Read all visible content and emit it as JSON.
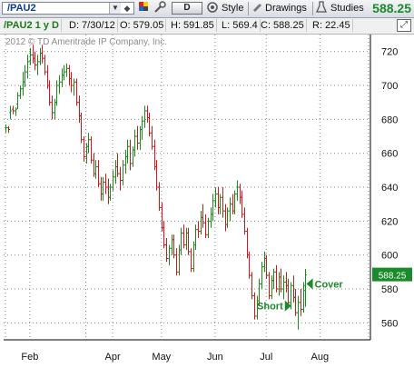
{
  "toolbar": {
    "symbol": "/PAU2",
    "dropdown_glyph": "▼",
    "draw_button": "D",
    "style_label": "Style",
    "drawings_label": "Drawings",
    "studies_label": "Studies",
    "last_price": "588.25",
    "last_price_color": "#1a8a2a"
  },
  "infobar": {
    "symbol_period": "/PAU2 1 y D",
    "date": "D: 7/30/12",
    "open": "O: 579.05",
    "high": "H: 591.85",
    "low": "L: 569.4",
    "close": "C: 588.25",
    "range": "R: 22.45"
  },
  "copyright": "2012 © TD Ameritrade IP Company, Inc.",
  "annotations": {
    "short_label": "Short",
    "cover_label": "Cover",
    "price_tag": "588.25"
  },
  "colors": {
    "up": "#1a8a1a",
    "down": "#cc1a1a",
    "grid": "#8a8a8a",
    "accent": "#1a8a2a"
  },
  "chart_data": {
    "type": "candlestick",
    "ylim": [
      550,
      730
    ],
    "y_ticks": [
      560,
      580,
      600,
      620,
      640,
      660,
      680,
      700,
      720
    ],
    "x_ticks": [
      "Feb",
      "Apr",
      "May",
      "Jun",
      "Jul",
      "Aug"
    ],
    "xlim": [
      0,
      149
    ],
    "x_tick_pos": [
      10,
      44,
      64,
      86,
      107,
      129
    ],
    "month_grid_pos": [
      0,
      10,
      33,
      44,
      64,
      86,
      107,
      129,
      149
    ],
    "last_close": 588.25,
    "short_signal_index": 118,
    "cover_signal_index": 122,
    "ohlc": [
      [
        675.0,
        677.0,
        672.0,
        675.0
      ],
      [
        675.0,
        676.0,
        672.0,
        674.0
      ],
      [
        684.0,
        688.0,
        680.0,
        685.0
      ],
      [
        686.0,
        688.0,
        683.0,
        685.0
      ],
      [
        685.0,
        687.0,
        682.0,
        686.0
      ],
      [
        689.0,
        696.0,
        686.0,
        694.0
      ],
      [
        694.0,
        700.0,
        692.0,
        698.0
      ],
      [
        698.0,
        708.0,
        694.0,
        702.0
      ],
      [
        702.0,
        712.0,
        699.0,
        708.0
      ],
      [
        708.0,
        718.0,
        704.0,
        714.0
      ],
      [
        714.0,
        722.0,
        712.0,
        718.0
      ],
      [
        718.0,
        724.0,
        713.0,
        716.0
      ],
      [
        716.0,
        720.0,
        709.0,
        712.0
      ],
      [
        712.0,
        718.0,
        706.0,
        714.0
      ],
      [
        714.0,
        722.0,
        712.0,
        719.0
      ],
      [
        719.0,
        724.0,
        713.0,
        716.0
      ],
      [
        716.0,
        718.0,
        706.0,
        708.0
      ],
      [
        708.0,
        712.0,
        698.0,
        700.0
      ],
      [
        700.0,
        703.0,
        688.0,
        690.0
      ],
      [
        690.0,
        694.0,
        680.0,
        684.0
      ],
      [
        684.0,
        692.0,
        680.0,
        690.0
      ],
      [
        690.0,
        703.0,
        688.0,
        700.0
      ],
      [
        700.0,
        706.0,
        695.0,
        702.0
      ],
      [
        702.0,
        710.0,
        699.0,
        706.0
      ],
      [
        706.0,
        712.0,
        703.0,
        708.0
      ],
      [
        708.0,
        713.0,
        705.0,
        710.0
      ],
      [
        710.0,
        712.0,
        700.0,
        704.0
      ],
      [
        704.0,
        708.0,
        696.0,
        700.0
      ],
      [
        700.0,
        704.0,
        694.0,
        702.0
      ],
      [
        702.0,
        704.0,
        688.0,
        690.0
      ],
      [
        690.0,
        694.0,
        678.0,
        682.0
      ],
      [
        682.0,
        684.0,
        666.0,
        668.0
      ],
      [
        668.0,
        670.0,
        655.0,
        658.0
      ],
      [
        658.0,
        666.0,
        654.0,
        664.0
      ],
      [
        664.0,
        672.0,
        660.0,
        668.0
      ],
      [
        668.0,
        670.0,
        654.0,
        656.0
      ],
      [
        656.0,
        660.0,
        646.0,
        648.0
      ],
      [
        648.0,
        656.0,
        645.0,
        652.0
      ],
      [
        652.0,
        656.0,
        640.0,
        642.0
      ],
      [
        642.0,
        646.0,
        632.0,
        636.0
      ],
      [
        636.0,
        646.0,
        632.0,
        643.0
      ],
      [
        643.0,
        648.0,
        636.0,
        640.0
      ],
      [
        640.0,
        645.0,
        630.0,
        634.0
      ],
      [
        634.0,
        642.0,
        632.0,
        640.0
      ],
      [
        640.0,
        650.0,
        638.0,
        646.0
      ],
      [
        646.0,
        656.0,
        642.0,
        652.0
      ],
      [
        652.0,
        660.0,
        646.0,
        648.0
      ],
      [
        648.0,
        652.0,
        638.0,
        644.0
      ],
      [
        644.0,
        656.0,
        641.0,
        653.0
      ],
      [
        653.0,
        662.0,
        648.0,
        658.0
      ],
      [
        658.0,
        668.0,
        654.0,
        664.0
      ],
      [
        664.0,
        668.0,
        650.0,
        654.0
      ],
      [
        654.0,
        664.0,
        652.0,
        662.0
      ],
      [
        662.0,
        674.0,
        658.0,
        670.0
      ],
      [
        670.0,
        676.0,
        662.0,
        666.0
      ],
      [
        666.0,
        676.0,
        662.0,
        674.0
      ],
      [
        674.0,
        682.0,
        668.0,
        679.0
      ],
      [
        679.0,
        688.0,
        675.0,
        685.0
      ],
      [
        685.0,
        688.0,
        678.0,
        681.0
      ],
      [
        681.0,
        684.0,
        670.0,
        672.0
      ],
      [
        672.0,
        676.0,
        662.0,
        664.0
      ],
      [
        664.0,
        668.0,
        650.0,
        652.0
      ],
      [
        652.0,
        656.0,
        638.0,
        640.0
      ],
      [
        640.0,
        643.0,
        626.0,
        628.0
      ],
      [
        628.0,
        631.0,
        614.0,
        616.0
      ],
      [
        616.0,
        620.0,
        604.0,
        606.0
      ],
      [
        606.0,
        610.0,
        596.0,
        598.0
      ],
      [
        598.0,
        606.0,
        594.0,
        604.0
      ],
      [
        604.0,
        612.0,
        600.0,
        609.0
      ],
      [
        609.0,
        612.0,
        598.0,
        600.0
      ],
      [
        600.0,
        604.0,
        588.0,
        590.0
      ],
      [
        590.0,
        606.0,
        588.0,
        603.0
      ],
      [
        603.0,
        616.0,
        600.0,
        613.0
      ],
      [
        613.0,
        618.0,
        604.0,
        606.0
      ],
      [
        606.0,
        616.0,
        603.0,
        613.0
      ],
      [
        613.0,
        616.0,
        600.0,
        602.0
      ],
      [
        602.0,
        604.0,
        590.0,
        592.0
      ],
      [
        592.0,
        608.0,
        590.0,
        606.0
      ],
      [
        606.0,
        618.0,
        603.0,
        615.0
      ],
      [
        615.0,
        620.0,
        610.0,
        614.0
      ],
      [
        614.0,
        626.0,
        612.0,
        622.0
      ],
      [
        622.0,
        630.0,
        616.0,
        619.0
      ],
      [
        619.0,
        624.0,
        610.0,
        612.0
      ],
      [
        612.0,
        622.0,
        610.0,
        620.0
      ],
      [
        620.0,
        628.0,
        616.0,
        624.0
      ],
      [
        624.0,
        636.0,
        620.0,
        632.0
      ],
      [
        632.0,
        640.0,
        628.0,
        636.0
      ],
      [
        636.0,
        640.0,
        624.0,
        628.0
      ],
      [
        628.0,
        636.0,
        624.0,
        634.0
      ],
      [
        634.0,
        640.0,
        622.0,
        626.0
      ],
      [
        626.0,
        630.0,
        614.0,
        618.0
      ],
      [
        618.0,
        628.0,
        616.0,
        626.0
      ],
      [
        626.0,
        634.0,
        620.0,
        630.0
      ],
      [
        630.0,
        636.0,
        624.0,
        626.0
      ],
      [
        626.0,
        638.0,
        624.0,
        636.0
      ],
      [
        636.0,
        644.0,
        632.0,
        640.0
      ],
      [
        640.0,
        642.0,
        630.0,
        634.0
      ],
      [
        634.0,
        638.0,
        622.0,
        624.0
      ],
      [
        624.0,
        628.0,
        612.0,
        614.0
      ],
      [
        614.0,
        616.0,
        598.0,
        600.0
      ],
      [
        600.0,
        602.0,
        586.0,
        588.0
      ],
      [
        588.0,
        590.0,
        574.0,
        576.0
      ],
      [
        576.0,
        578.0,
        562.0,
        564.0
      ],
      [
        564.0,
        576.0,
        562.0,
        573.0
      ],
      [
        573.0,
        586.0,
        570.0,
        583.0
      ],
      [
        583.0,
        596.0,
        580.0,
        593.0
      ],
      [
        593.0,
        602.0,
        590.0,
        598.0
      ],
      [
        598.0,
        600.0,
        586.0,
        588.0
      ],
      [
        588.0,
        590.0,
        574.0,
        576.0
      ],
      [
        576.0,
        588.0,
        574.0,
        585.0
      ],
      [
        585.0,
        592.0,
        580.0,
        590.0
      ],
      [
        590.0,
        594.0,
        578.0,
        580.0
      ],
      [
        580.0,
        590.0,
        576.0,
        587.0
      ],
      [
        587.0,
        592.0,
        578.0,
        580.0
      ],
      [
        580.0,
        588.0,
        574.0,
        584.0
      ],
      [
        584.0,
        590.0,
        578.0,
        582.0
      ],
      [
        582.0,
        586.0,
        570.0,
        572.0
      ],
      [
        572.0,
        584.0,
        568.0,
        582.0
      ],
      [
        582.0,
        588.0,
        572.0,
        575.0
      ],
      [
        575.0,
        580.0,
        564.0,
        566.0
      ],
      [
        566.0,
        576.0,
        556.0,
        572.0
      ],
      [
        572.0,
        580.0,
        564.0,
        568.0
      ],
      [
        568.0,
        584.0,
        566.0,
        582.0
      ],
      [
        579.05,
        591.85,
        569.4,
        588.25
      ]
    ]
  }
}
